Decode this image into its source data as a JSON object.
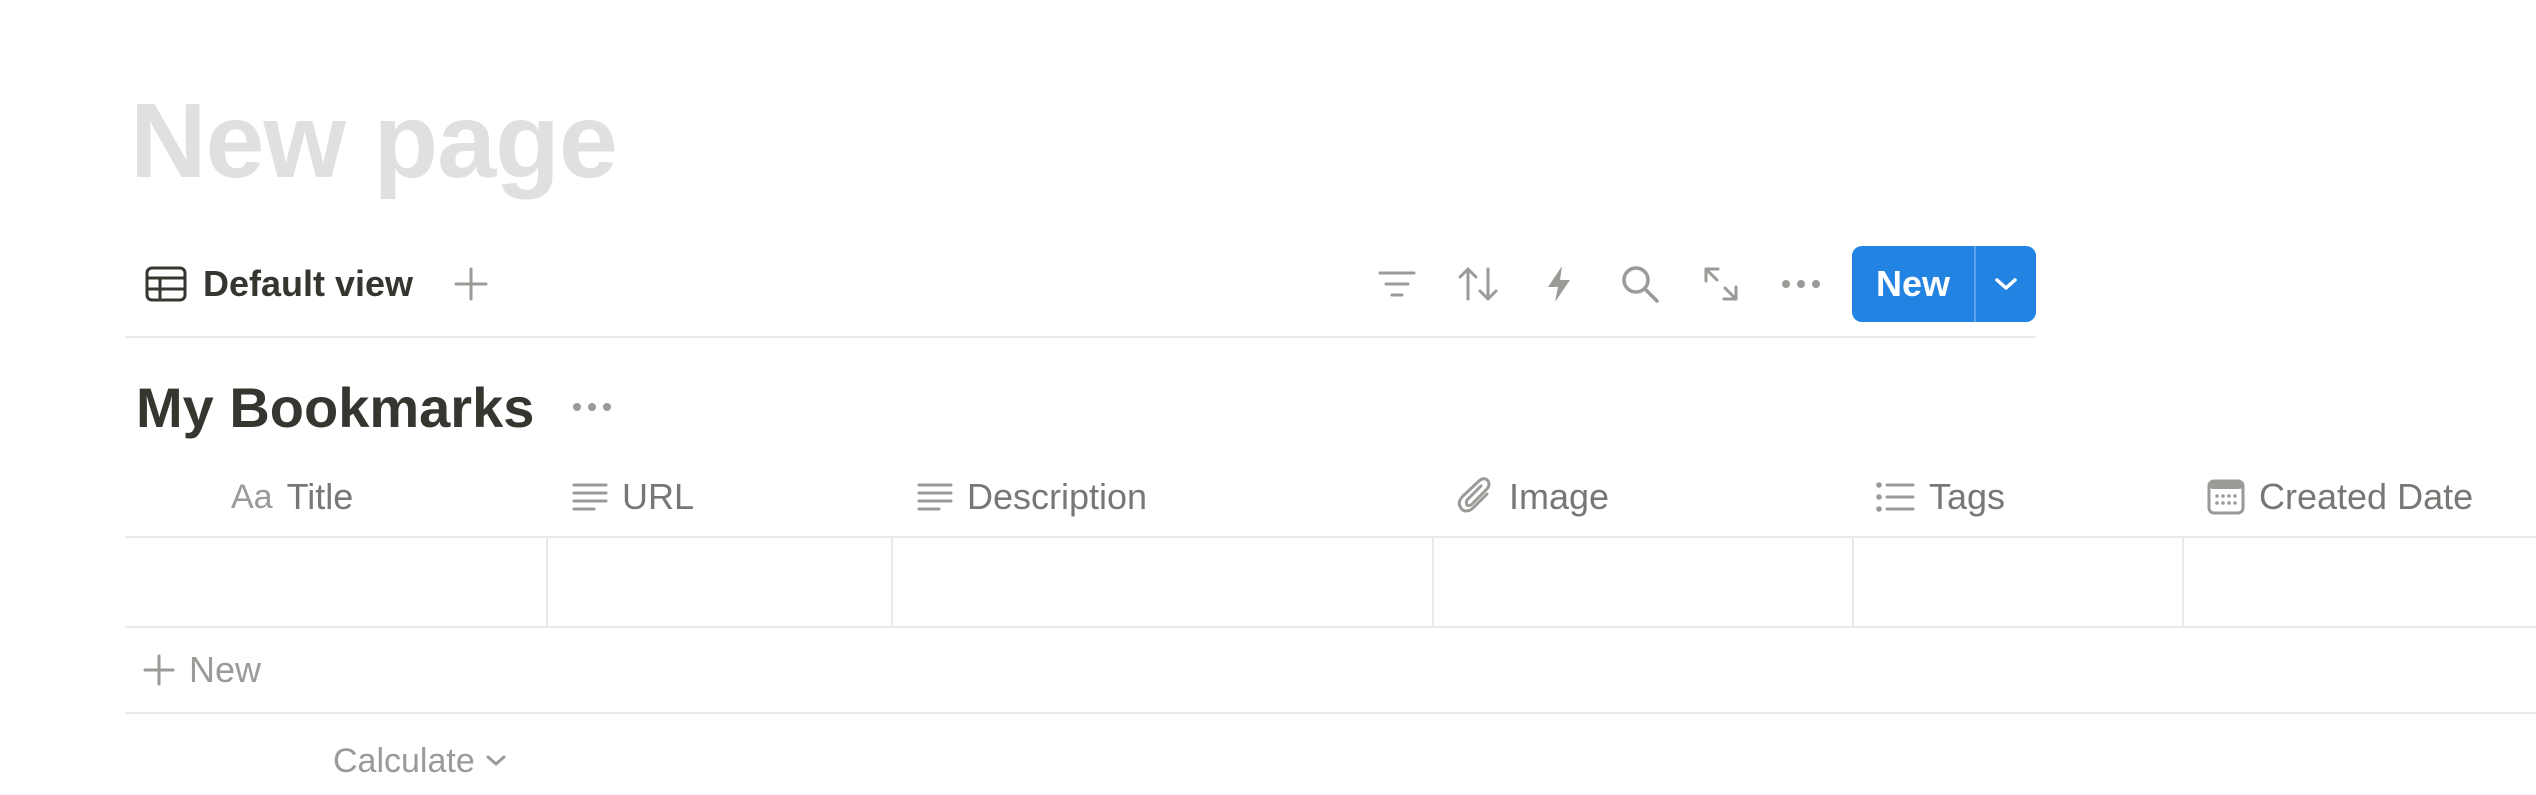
{
  "page": {
    "title": "New page"
  },
  "view_bar": {
    "view_label": "Default view",
    "view_icon": "table-icon",
    "add_view_icon": "plus-icon",
    "toolbar_icons": [
      "filter-icon",
      "sort-icon",
      "automation-bolt-icon",
      "search-icon",
      "expand-icon",
      "more-icon"
    ],
    "new_button_label": "New",
    "accent_color": "#2383e2"
  },
  "database": {
    "title": "My Bookmarks",
    "columns": [
      {
        "label": "Title",
        "icon": "aa-text-icon"
      },
      {
        "label": "URL",
        "icon": "text-lines-icon"
      },
      {
        "label": "Description",
        "icon": "text-lines-icon"
      },
      {
        "label": "Image",
        "icon": "paperclip-icon"
      },
      {
        "label": "Tags",
        "icon": "list-icon"
      },
      {
        "label": "Created Date",
        "icon": "calendar-icon"
      }
    ],
    "aa_glyph": "Aa",
    "new_row_label": "New",
    "calculate_label": "Calculate"
  }
}
